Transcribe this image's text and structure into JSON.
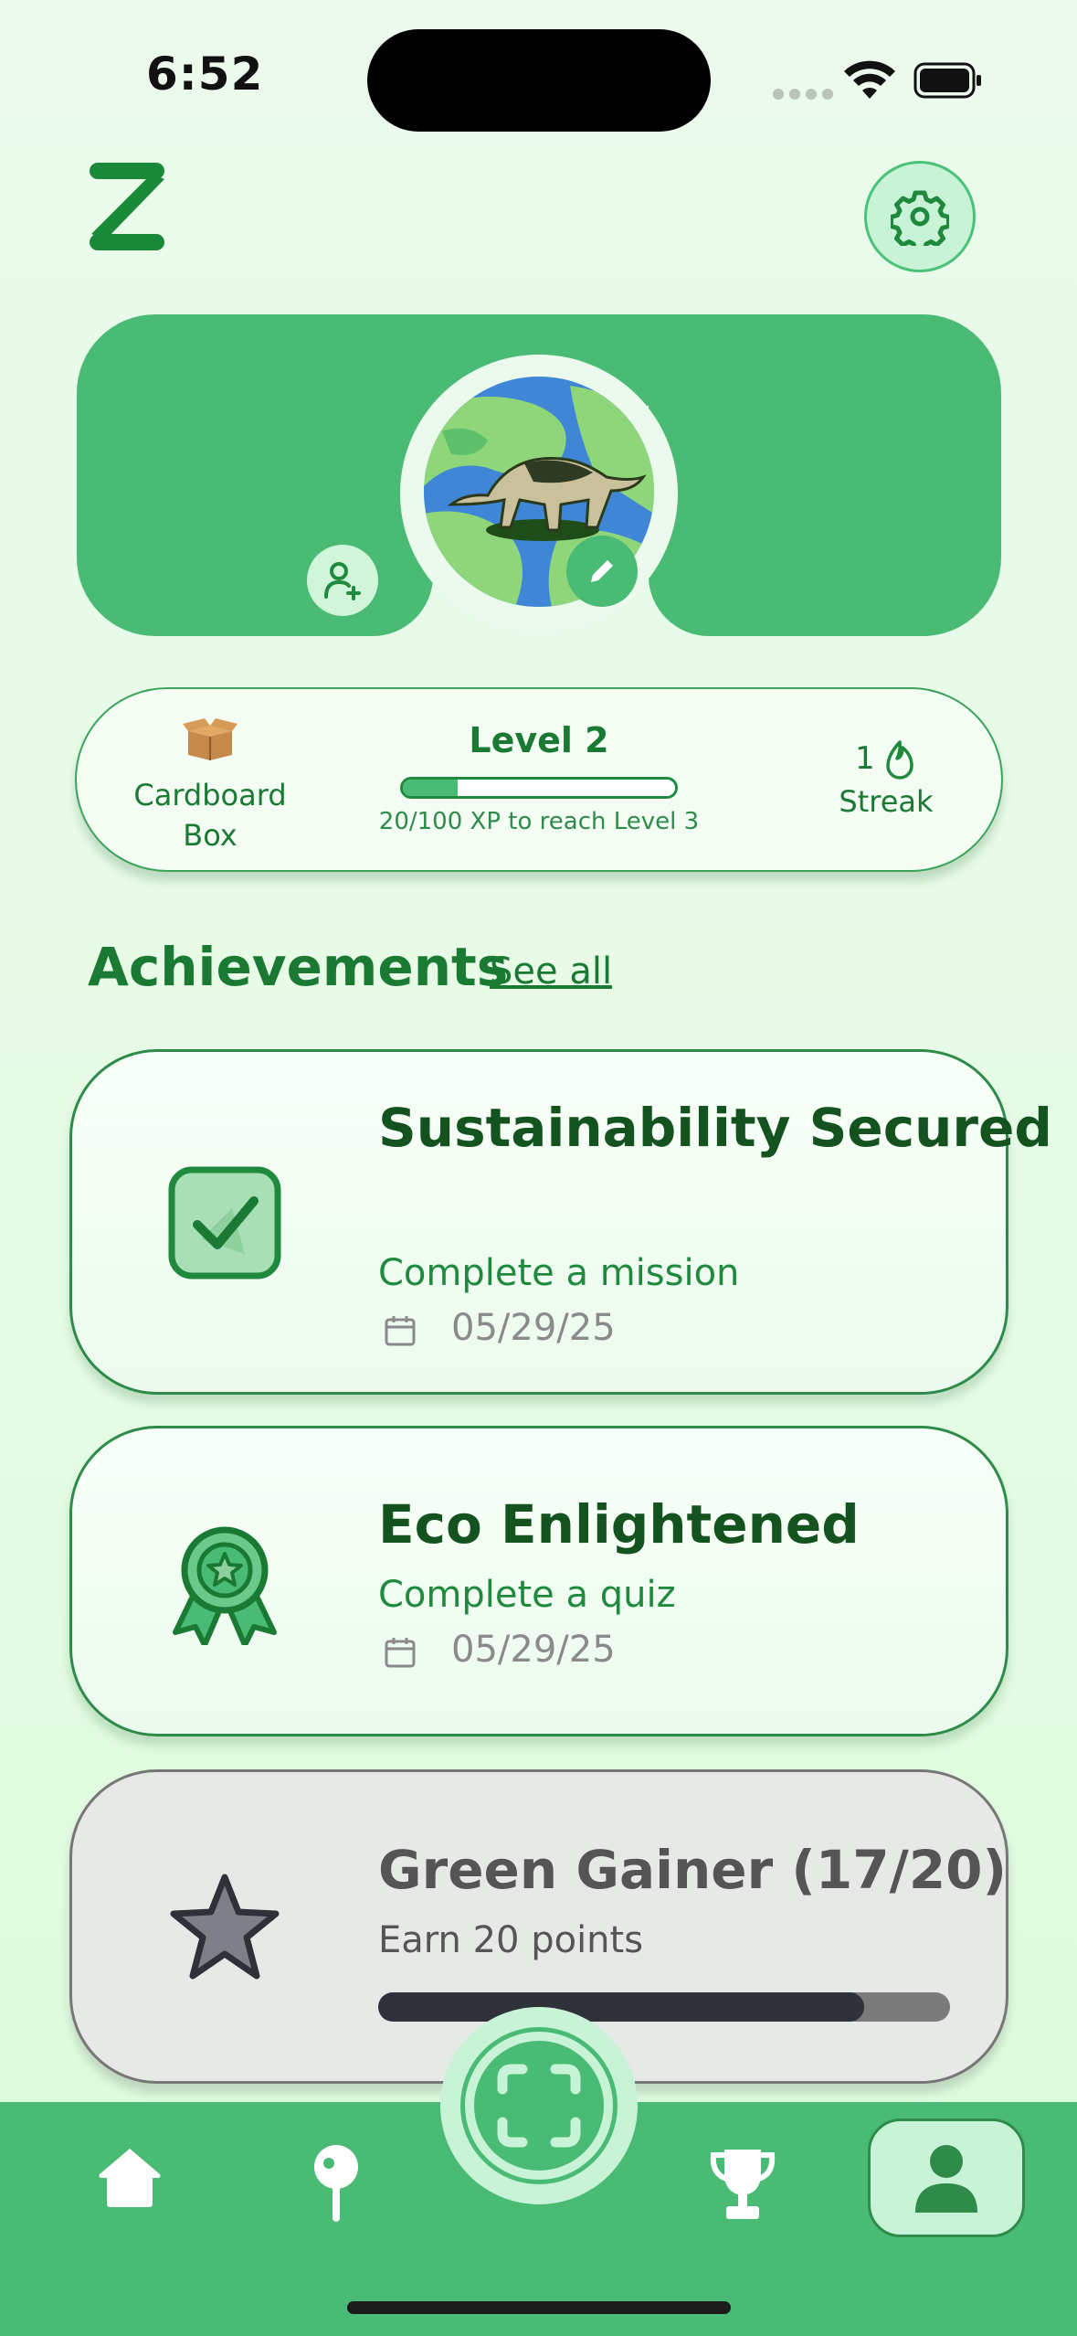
{
  "status_bar": {
    "time": "6:52"
  },
  "profile": {
    "level_title": "Level 2",
    "xp_progress": 0.2,
    "xp_text": "20/100 XP to reach Level 3",
    "box_label": "Cardboard Box",
    "streak_count": "1",
    "streak_label": "Streak"
  },
  "achievements": {
    "title": "Achievements",
    "see_all": "See all",
    "items": [
      {
        "title": "Sustainability Secured",
        "subtitle": "Complete a mission",
        "date": "05/29/25",
        "icon": "checkbox-icon",
        "status": "earned"
      },
      {
        "title": "Eco Enlightened",
        "subtitle": "Complete a quiz",
        "date": "05/29/25",
        "icon": "award-ribbon-icon",
        "status": "earned"
      },
      {
        "title": "Green Gainer (17/20)",
        "subtitle": "Earn 20 points",
        "progress": 0.85,
        "icon": "star-icon",
        "status": "in-progress"
      }
    ]
  },
  "nav": {
    "tabs": [
      "home-icon",
      "map-pin-icon",
      "scan-icon",
      "trophy-icon",
      "profile-icon"
    ],
    "active": "profile-icon"
  },
  "colors": {
    "primary_green": "#49bb75",
    "dark_green": "#1a7a33",
    "light_green": "#c8f3d6",
    "locked_grey": "#e6e9e6"
  }
}
